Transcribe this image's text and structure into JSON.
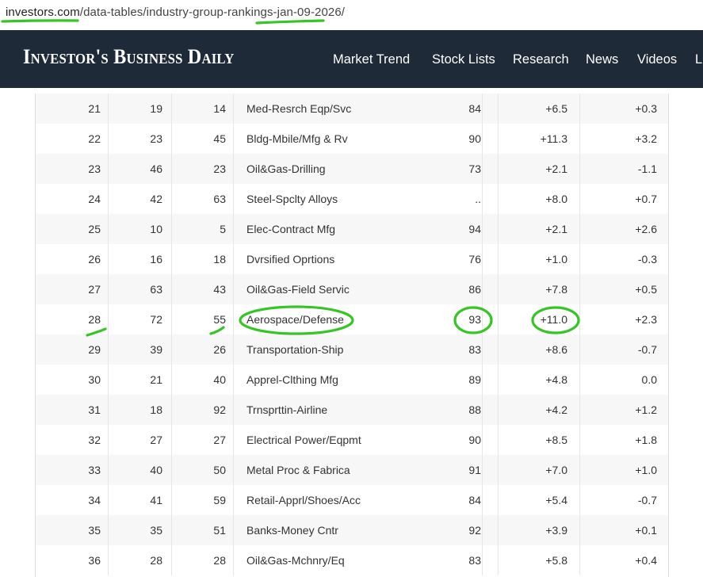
{
  "url": {
    "domain": "investors.com",
    "path": "/data-tables/industry-group-rankings-jan-09-2026/"
  },
  "header": {
    "logo": "Investor's Business Daily",
    "nav": [
      "Market Trend",
      "Stock Lists",
      "Research",
      "News",
      "Videos",
      "L"
    ]
  },
  "table": {
    "rows": [
      [
        "21",
        "19",
        "14",
        "Med-Resrch Eqp/Svc",
        "84",
        "+6.5",
        "+0.3"
      ],
      [
        "22",
        "23",
        "45",
        "Bldg-Mbile/Mfg & Rv",
        "90",
        "+11.3",
        "+3.2"
      ],
      [
        "23",
        "46",
        "23",
        "Oil&Gas-Drilling",
        "73",
        "+2.1",
        "-1.1"
      ],
      [
        "24",
        "42",
        "63",
        "Steel-Spclty Alloys",
        "..",
        "+8.0",
        "+0.7"
      ],
      [
        "25",
        "10",
        "5",
        "Elec-Contract Mfg",
        "94",
        "+2.1",
        "+2.6"
      ],
      [
        "26",
        "16",
        "18",
        "Dvrsified Oprtions",
        "76",
        "+1.0",
        "-0.3"
      ],
      [
        "27",
        "63",
        "43",
        "Oil&Gas-Field Servic",
        "86",
        "+7.8",
        "+0.5"
      ],
      [
        "28",
        "72",
        "55",
        "Aerospace/Defense",
        "93",
        "+11.0",
        "+2.3"
      ],
      [
        "29",
        "39",
        "26",
        "Transportation-Ship",
        "83",
        "+8.6",
        "-0.7"
      ],
      [
        "30",
        "21",
        "40",
        "Apprel-Clthing Mfg",
        "89",
        "+4.8",
        "0.0"
      ],
      [
        "31",
        "18",
        "92",
        "Trnsprttin-Airline",
        "88",
        "+4.2",
        "+1.2"
      ],
      [
        "32",
        "27",
        "27",
        "Electrical Power/Eqpmt",
        "90",
        "+8.5",
        "+1.8"
      ],
      [
        "33",
        "40",
        "50",
        "Metal Proc & Fabrica",
        "91",
        "+7.0",
        "+1.0"
      ],
      [
        "34",
        "41",
        "59",
        "Retail-Apprl/Shoes/Acc",
        "84",
        "+5.4",
        "-0.7"
      ],
      [
        "35",
        "35",
        "51",
        "Banks-Money Cntr",
        "92",
        "+3.9",
        "+0.1"
      ],
      [
        "36",
        "28",
        "28",
        "Oil&Gas-Mchnry/Eq",
        "83",
        "+5.8",
        "+0.4"
      ]
    ]
  },
  "annotation": {
    "color": "#35c626"
  }
}
